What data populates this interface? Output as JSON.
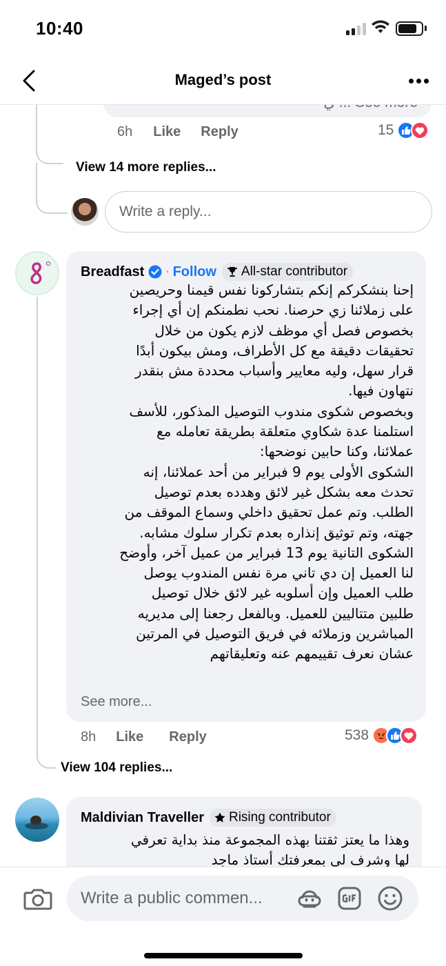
{
  "status_bar": {
    "time": "10:40"
  },
  "nav": {
    "title": "Maged’s post"
  },
  "previous_reply": {
    "clipped_text": "ي ... See more",
    "time": "6h",
    "like_label": "Like",
    "reply_label": "Reply",
    "reaction_count": "15",
    "reactions": [
      "like-icon",
      "love-icon"
    ]
  },
  "view_more_replies": "View 14 more replies...",
  "reply_box": {
    "placeholder": "Write a reply..."
  },
  "comment_breadfast": {
    "author": "Breadfast",
    "verified": true,
    "follow_label": "Follow",
    "badge": "All-star contributor",
    "text": "إحنا بنشكركم إنكم بتشاركونا نفس قيمنا وحريصين\nعلى زملائنا زي حرصنا. نحب نطمنكم إن أي إجراء\nبخصوص فصل أي موظف لازم يكون من خلال\nتحقيقات دقيقة مع كل الأطراف، ومش بيكون أبدًا\nقرار سهل، وليه معايير وأسباب محددة مش بنقدر\nنتهاون فيها.\nوبخصوص شكوى مندوب التوصيل المذكور، للأسف\nاستلمنا عدة شكاوي متعلقة بطريقة تعامله مع\nعملائنا، وكنا حابين نوضحها:\nالشكوى الأولى يوم 9 فبراير من أحد عملائنا، إنه\nتحدث معه بشكل غير لائق وهدده بعدم توصيل\nالطلب. وتم عمل تحقيق داخلي وسماع الموقف من\nجهته، وتم توثيق إنذاره بعدم تكرار سلوك مشابه.\nالشكوى التانية يوم 13 فبراير من عميل آخر، وأوضح\nلنا العميل إن دي تاني مرة نفس المندوب يوصل\nطلب العميل وإن أسلوبه غير لائق خلال توصيل\nطلبين متتاليين للعميل. وبالفعل رجعنا إلى مديريه\nالمباشرين وزملائه في فريق التوصيل في المرتين\nعشان نعرف تقييمهم عنه وتعليقاتهم",
    "see_more": "See more...",
    "time": "8h",
    "like_label": "Like",
    "reply_label": "Reply",
    "reaction_count": "538",
    "reactions": [
      "angry-icon",
      "like-icon",
      "love-icon"
    ]
  },
  "view_replies": "View 104 replies...",
  "comment_maldivian": {
    "author": "Maldivian Traveller",
    "badge": "Rising contributor",
    "text": "وهذا ما يعتز ثقتنا بهذه المجموعة منذ بداية تعرفي\nلها وشرف لي بمعرفتك أستاذ ماجد"
  },
  "bottom_bar": {
    "placeholder": "Write a public commen..."
  },
  "colors": {
    "accent": "#1877f2",
    "bubble": "#f0f2f5",
    "secondary_text": "#65676b",
    "love": "#f33e58",
    "angry": "#f7714c"
  }
}
